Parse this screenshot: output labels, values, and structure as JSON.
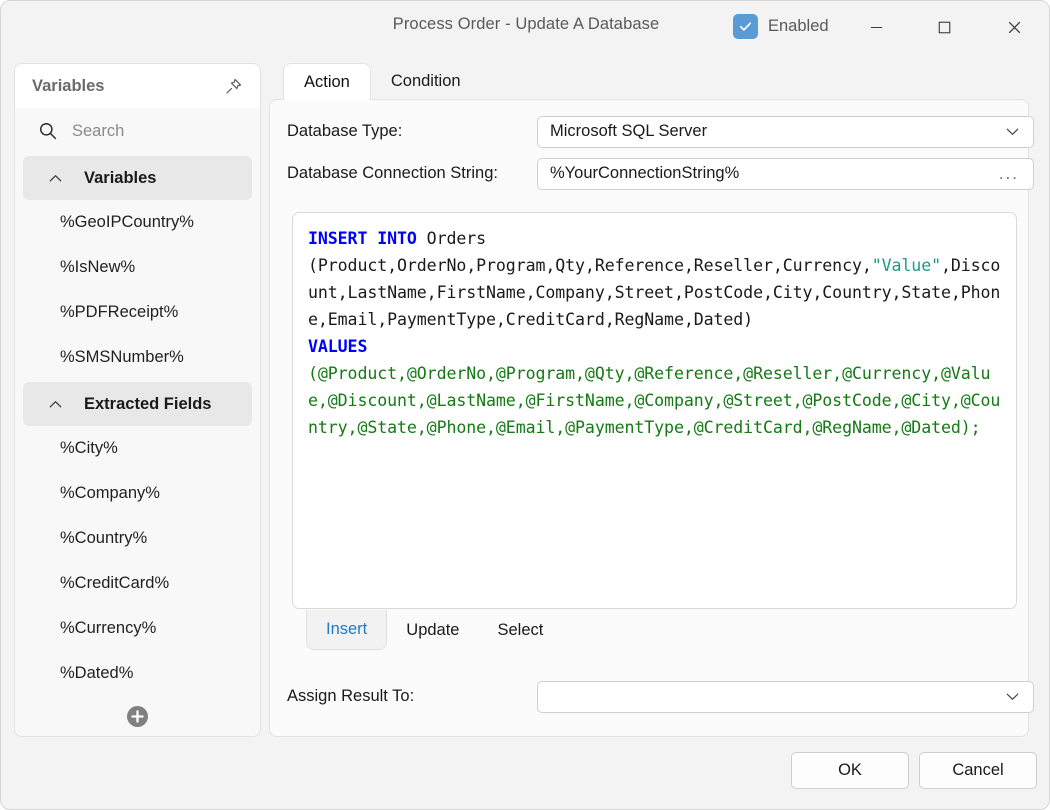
{
  "window": {
    "title": "Process Order - Update A Database",
    "enabled_label": "Enabled",
    "checkbox_checked": true,
    "accent_color": "#5b9bd5",
    "controls": {
      "minimize": "minimize-icon",
      "maximize": "maximize-icon",
      "close": "close-icon"
    }
  },
  "sidebar": {
    "title": "Variables",
    "pin_icon": "pin-icon",
    "search": {
      "icon": "search-icon",
      "placeholder": "Search",
      "value": ""
    },
    "groups": [
      {
        "label": "Variables",
        "expanded": true,
        "items": [
          "%GeoIPCountry%",
          "%IsNew%",
          "%PDFReceipt%",
          "%SMSNumber%"
        ]
      },
      {
        "label": "Extracted Fields",
        "expanded": true,
        "items": [
          "%City%",
          "%Company%",
          "%Country%",
          "%CreditCard%",
          "%Currency%",
          "%Dated%"
        ]
      }
    ],
    "add_button": "add-icon"
  },
  "main": {
    "tabs": [
      {
        "label": "Action",
        "active": true
      },
      {
        "label": "Condition",
        "active": false
      }
    ],
    "fields": {
      "database_type": {
        "label": "Database Type:",
        "value": "Microsoft SQL Server",
        "options": [
          "Microsoft SQL Server"
        ]
      },
      "connection_string": {
        "label": "Database Connection String:",
        "value": "%YourConnectionString%",
        "browse_label": "..."
      },
      "assign_result": {
        "label": "Assign Result To:",
        "value": "",
        "options": []
      }
    },
    "editor": {
      "sql_lines": [
        "INSERT INTO Orders",
        "(Product,OrderNo,Program,Qty,Reference,Reseller,Currency,\"Value\",Discount,LastName,FirstName,Company,Street,PostCode,City,Country,State,Phone,Email,PaymentType,CreditCard,RegName,Dated)",
        "VALUES",
        "(@Product,@OrderNo,@Program,@Qty,@Reference,@Reseller,@Currency,@Value,@Discount,@LastName,@FirstName,@Company,@Street,@PostCode,@City,@Country,@State,@Phone,@Email,@PaymentType,@CreditCard,@RegName,@Dated);"
      ],
      "keyword_color": "#0000ff",
      "string_color": "#1a9b8a",
      "param_color": "#157a15"
    },
    "query_tabs": [
      {
        "label": "Insert",
        "active": true
      },
      {
        "label": "Update",
        "active": false
      },
      {
        "label": "Select",
        "active": false
      }
    ]
  },
  "footer": {
    "ok_label": "OK",
    "cancel_label": "Cancel"
  }
}
